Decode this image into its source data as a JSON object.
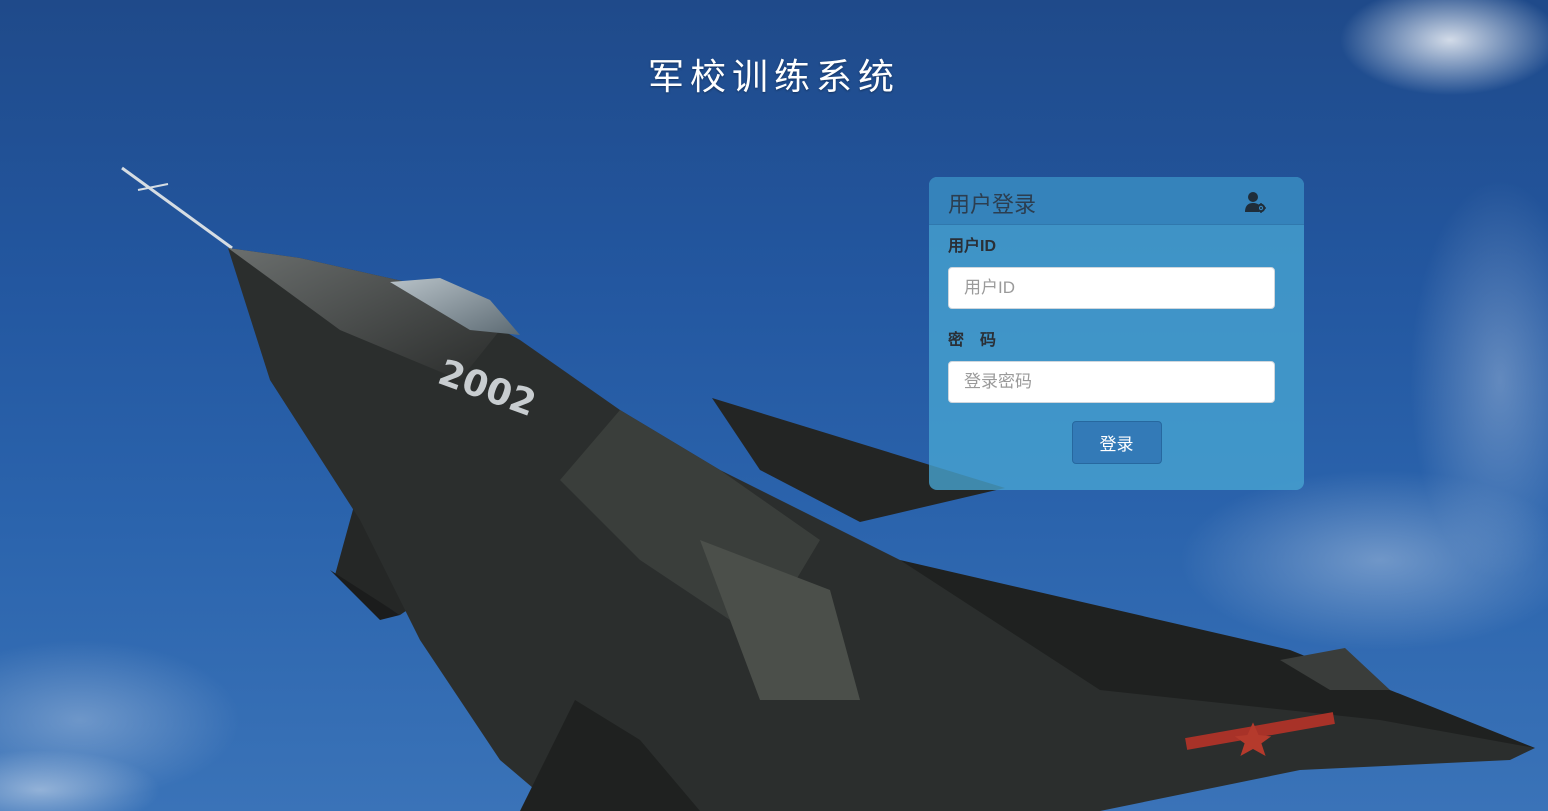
{
  "page": {
    "title": "军校训练系统",
    "aircraft_number": "2002"
  },
  "login": {
    "header": "用户登录",
    "header_icon": "user-gear-icon",
    "userid_label": "用户ID",
    "userid_placeholder": "用户ID",
    "password_label": "密　码",
    "password_placeholder": "登录密码",
    "submit_label": "登录"
  },
  "colors": {
    "sky_dark": "#1f4a8a",
    "sky_light": "#3a73b8",
    "panel": "#48a5d2",
    "panel_header": "#3480b8",
    "button": "#337ab7",
    "title_text": "#ffffff"
  }
}
